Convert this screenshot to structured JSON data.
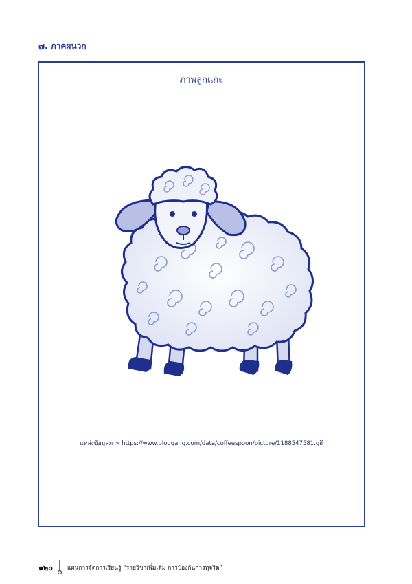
{
  "section_heading": "๗. ภาคผนวก",
  "figure": {
    "title": "ภาพลูกแกะ",
    "source_label": "แหล่งข้อมูลภาพ",
    "source_url": "https://www.bloggang.com/data/coffeespoon/picture/1188547581.gif"
  },
  "footer": {
    "page_number": "๑๒๐",
    "text": "แผนการจัดการเรียนรู้ “รายวิชาเพิ่มเติม การป้องกันการทุจริต”"
  },
  "colors": {
    "accent": "#2a3d8f",
    "sheep_outline": "#1f2f8c",
    "sheep_fill": "#e9ecf7"
  }
}
